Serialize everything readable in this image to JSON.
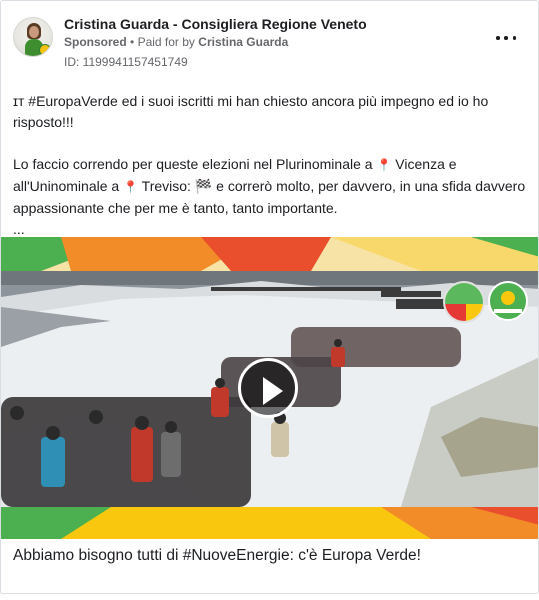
{
  "advertiser": {
    "name": "Cristina Guarda - Consigliera Regione Veneto",
    "sponsored_label": "Sponsored",
    "separator": "•",
    "paid_for_label": "Paid for by",
    "paid_for_name": "Cristina Guarda",
    "ad_id": "ID: 1199941157451749"
  },
  "post": {
    "line1_prefix": "ɪᴛ",
    "line1": "#EuropaVerde ed i suoi iscritti mi han chiesto ancora più impegno ed io ho risposto!!!",
    "line2_part1": "Lo faccio correndo per queste elezioni nel Plurinominale a",
    "line2_city1": "Vicenza e all'Uninominale a",
    "line2_city2": "Treviso:",
    "line2_flag": "🏁",
    "line2_part2": "e correrò molto, per davvero, in una sfida davvero appassionante che per me è tanto, tanto importante.",
    "ellipsis": "...",
    "pin_glyph": "📍"
  },
  "media": {
    "type": "video",
    "play_icon": "play-icon",
    "logos": [
      "europa-verde-sinistra-logo",
      "europa-verde-logo"
    ]
  },
  "caption": "Abbiamo bisogno tutti di #NuoveEnergie: c'è Europa Verde!",
  "colors": {
    "text": "#1c1e21",
    "secondary": "#65676b",
    "border": "#dadde1",
    "banner_orange": "#f28c28",
    "banner_green": "#4caf50",
    "banner_yellow": "#f9c80e"
  }
}
